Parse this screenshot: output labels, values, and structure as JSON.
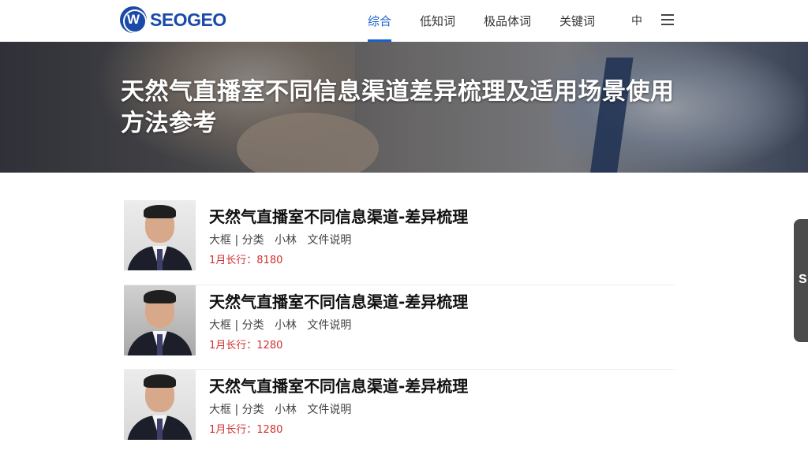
{
  "header": {
    "logo_mark": "W",
    "logo_text": "SEOGEO",
    "nav": [
      {
        "label": "综合",
        "active": true
      },
      {
        "label": "低知词",
        "active": false
      },
      {
        "label": "极品体词",
        "active": false
      },
      {
        "label": "关键词",
        "active": false
      }
    ],
    "lang": "中",
    "menu_icon": "hamburger-menu-icon"
  },
  "banner": {
    "title": "天然气直播室不同信息渠道差异梳理及适用场景使用方法参考"
  },
  "list": [
    {
      "title": "天然气直播室不同信息渠道-差异梳理",
      "meta": "大框 | 分类   小林   文件说明",
      "price": "1月长行：8180",
      "thumb_bg": "light"
    },
    {
      "title": "天然气直播室不同信息渠道-差异梳理",
      "meta": "大框 | 分类   小林   文件说明",
      "price": "1月长行：1280",
      "thumb_bg": "gray"
    },
    {
      "title": "天然气直播室不同信息渠道-差异梳理",
      "meta": "大框 | 分类   小林   文件说明",
      "price": "1月长行：1280",
      "thumb_bg": "light"
    }
  ],
  "float_tab": {
    "label": "S"
  },
  "colors": {
    "brand": "#1a4aa8",
    "active_nav": "#1a5fd0",
    "price": "#d03030"
  }
}
